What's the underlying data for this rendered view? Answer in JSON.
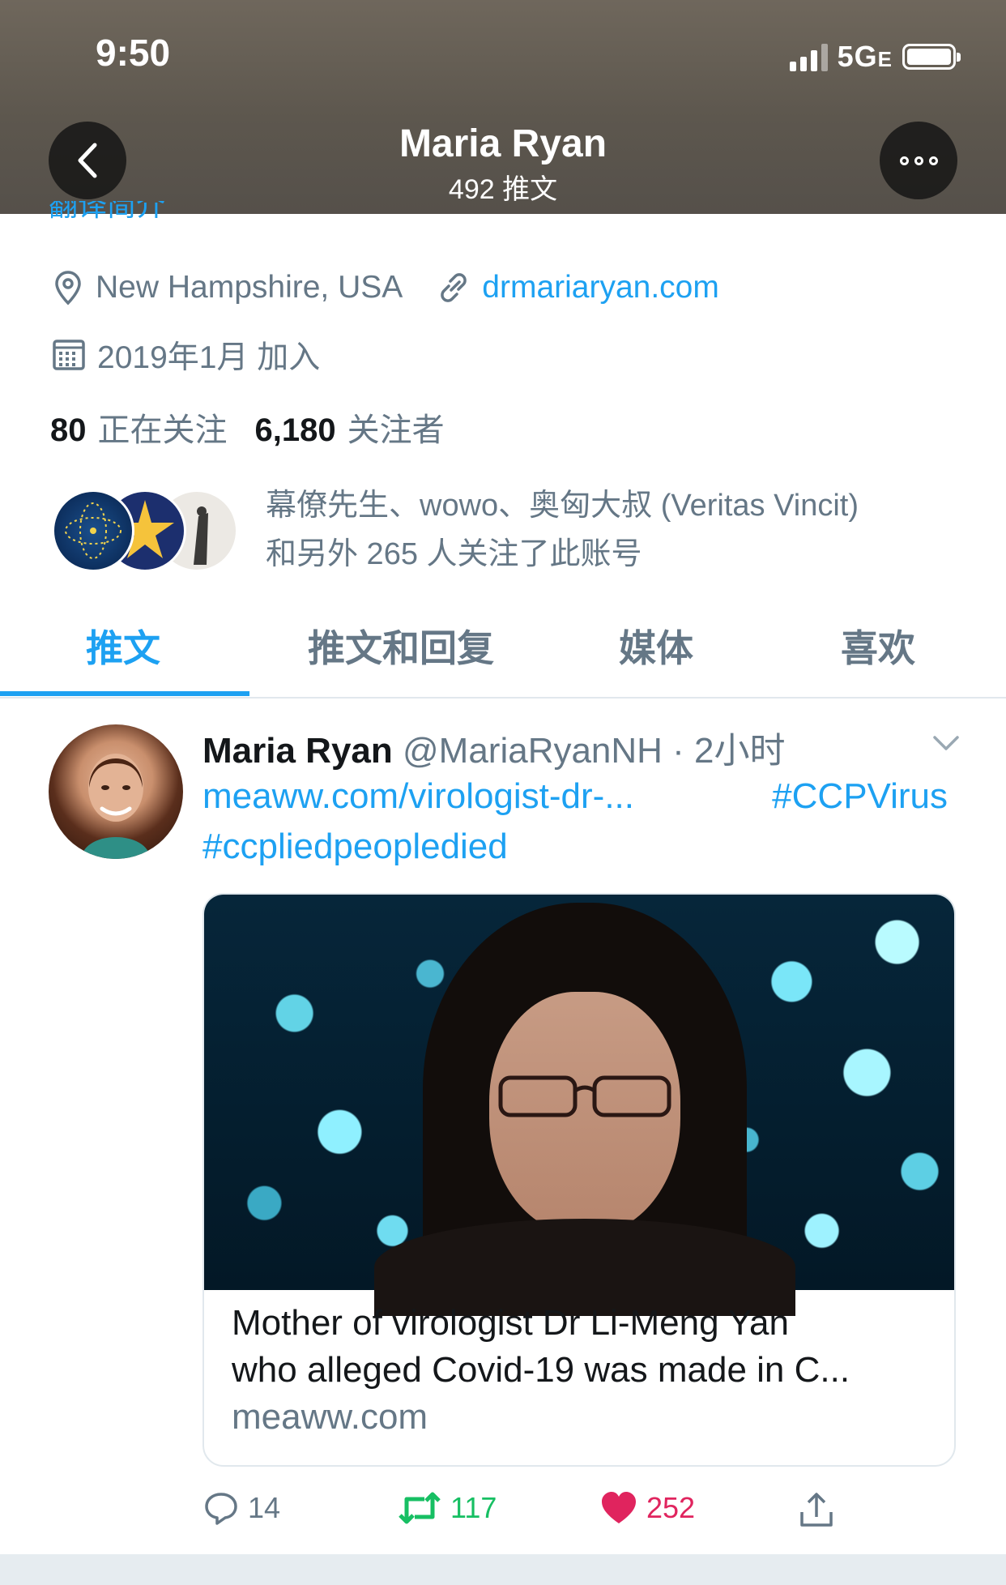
{
  "status_bar": {
    "time": "9:50",
    "network": "5G",
    "network_suffix": "E"
  },
  "header": {
    "name": "Maria Ryan",
    "tweet_count": "492 推文"
  },
  "profile": {
    "translate_bio": "翻译简介",
    "location": "New Hampshire, USA",
    "website": "drmariaryan.com",
    "joined": "2019年1月 加入",
    "following_count": "80",
    "following_label": "正在关注",
    "followers_count": "6,180",
    "followers_label": "关注者",
    "followed_by_line1": "幕僚先生、wowo、奥匈大叔 (Veritas Vincit)",
    "followed_by_line2": "和另外 265 人关注了此账号"
  },
  "tabs": [
    {
      "label": "推文",
      "active": true
    },
    {
      "label": "推文和回复",
      "active": false
    },
    {
      "label": "媒体",
      "active": false
    },
    {
      "label": "喜欢",
      "active": false
    }
  ],
  "tweet": {
    "author": "Maria Ryan",
    "handle": "@MariaRyanNH · 2小时",
    "link": "meaww.com/virologist-dr-...",
    "hashtag1": "#CCPVirus",
    "hashtag2": "#ccpliedpeopledied",
    "card": {
      "title_line1": "Mother of virologist Dr Li-Meng Yan",
      "title_line2": "who alleged Covid-19 was made in C...",
      "domain": "meaww.com"
    },
    "replies": "14",
    "retweets": "117",
    "likes": "252"
  },
  "colors": {
    "accent": "#1da1f2",
    "retweet": "#17bf63",
    "like": "#e0245e",
    "muted": "#657786"
  },
  "icons": [
    "back-icon",
    "more-icon",
    "location-icon",
    "link-icon",
    "calendar-icon",
    "caret-down-icon",
    "reply-icon",
    "retweet-icon",
    "heart-icon",
    "share-icon"
  ]
}
